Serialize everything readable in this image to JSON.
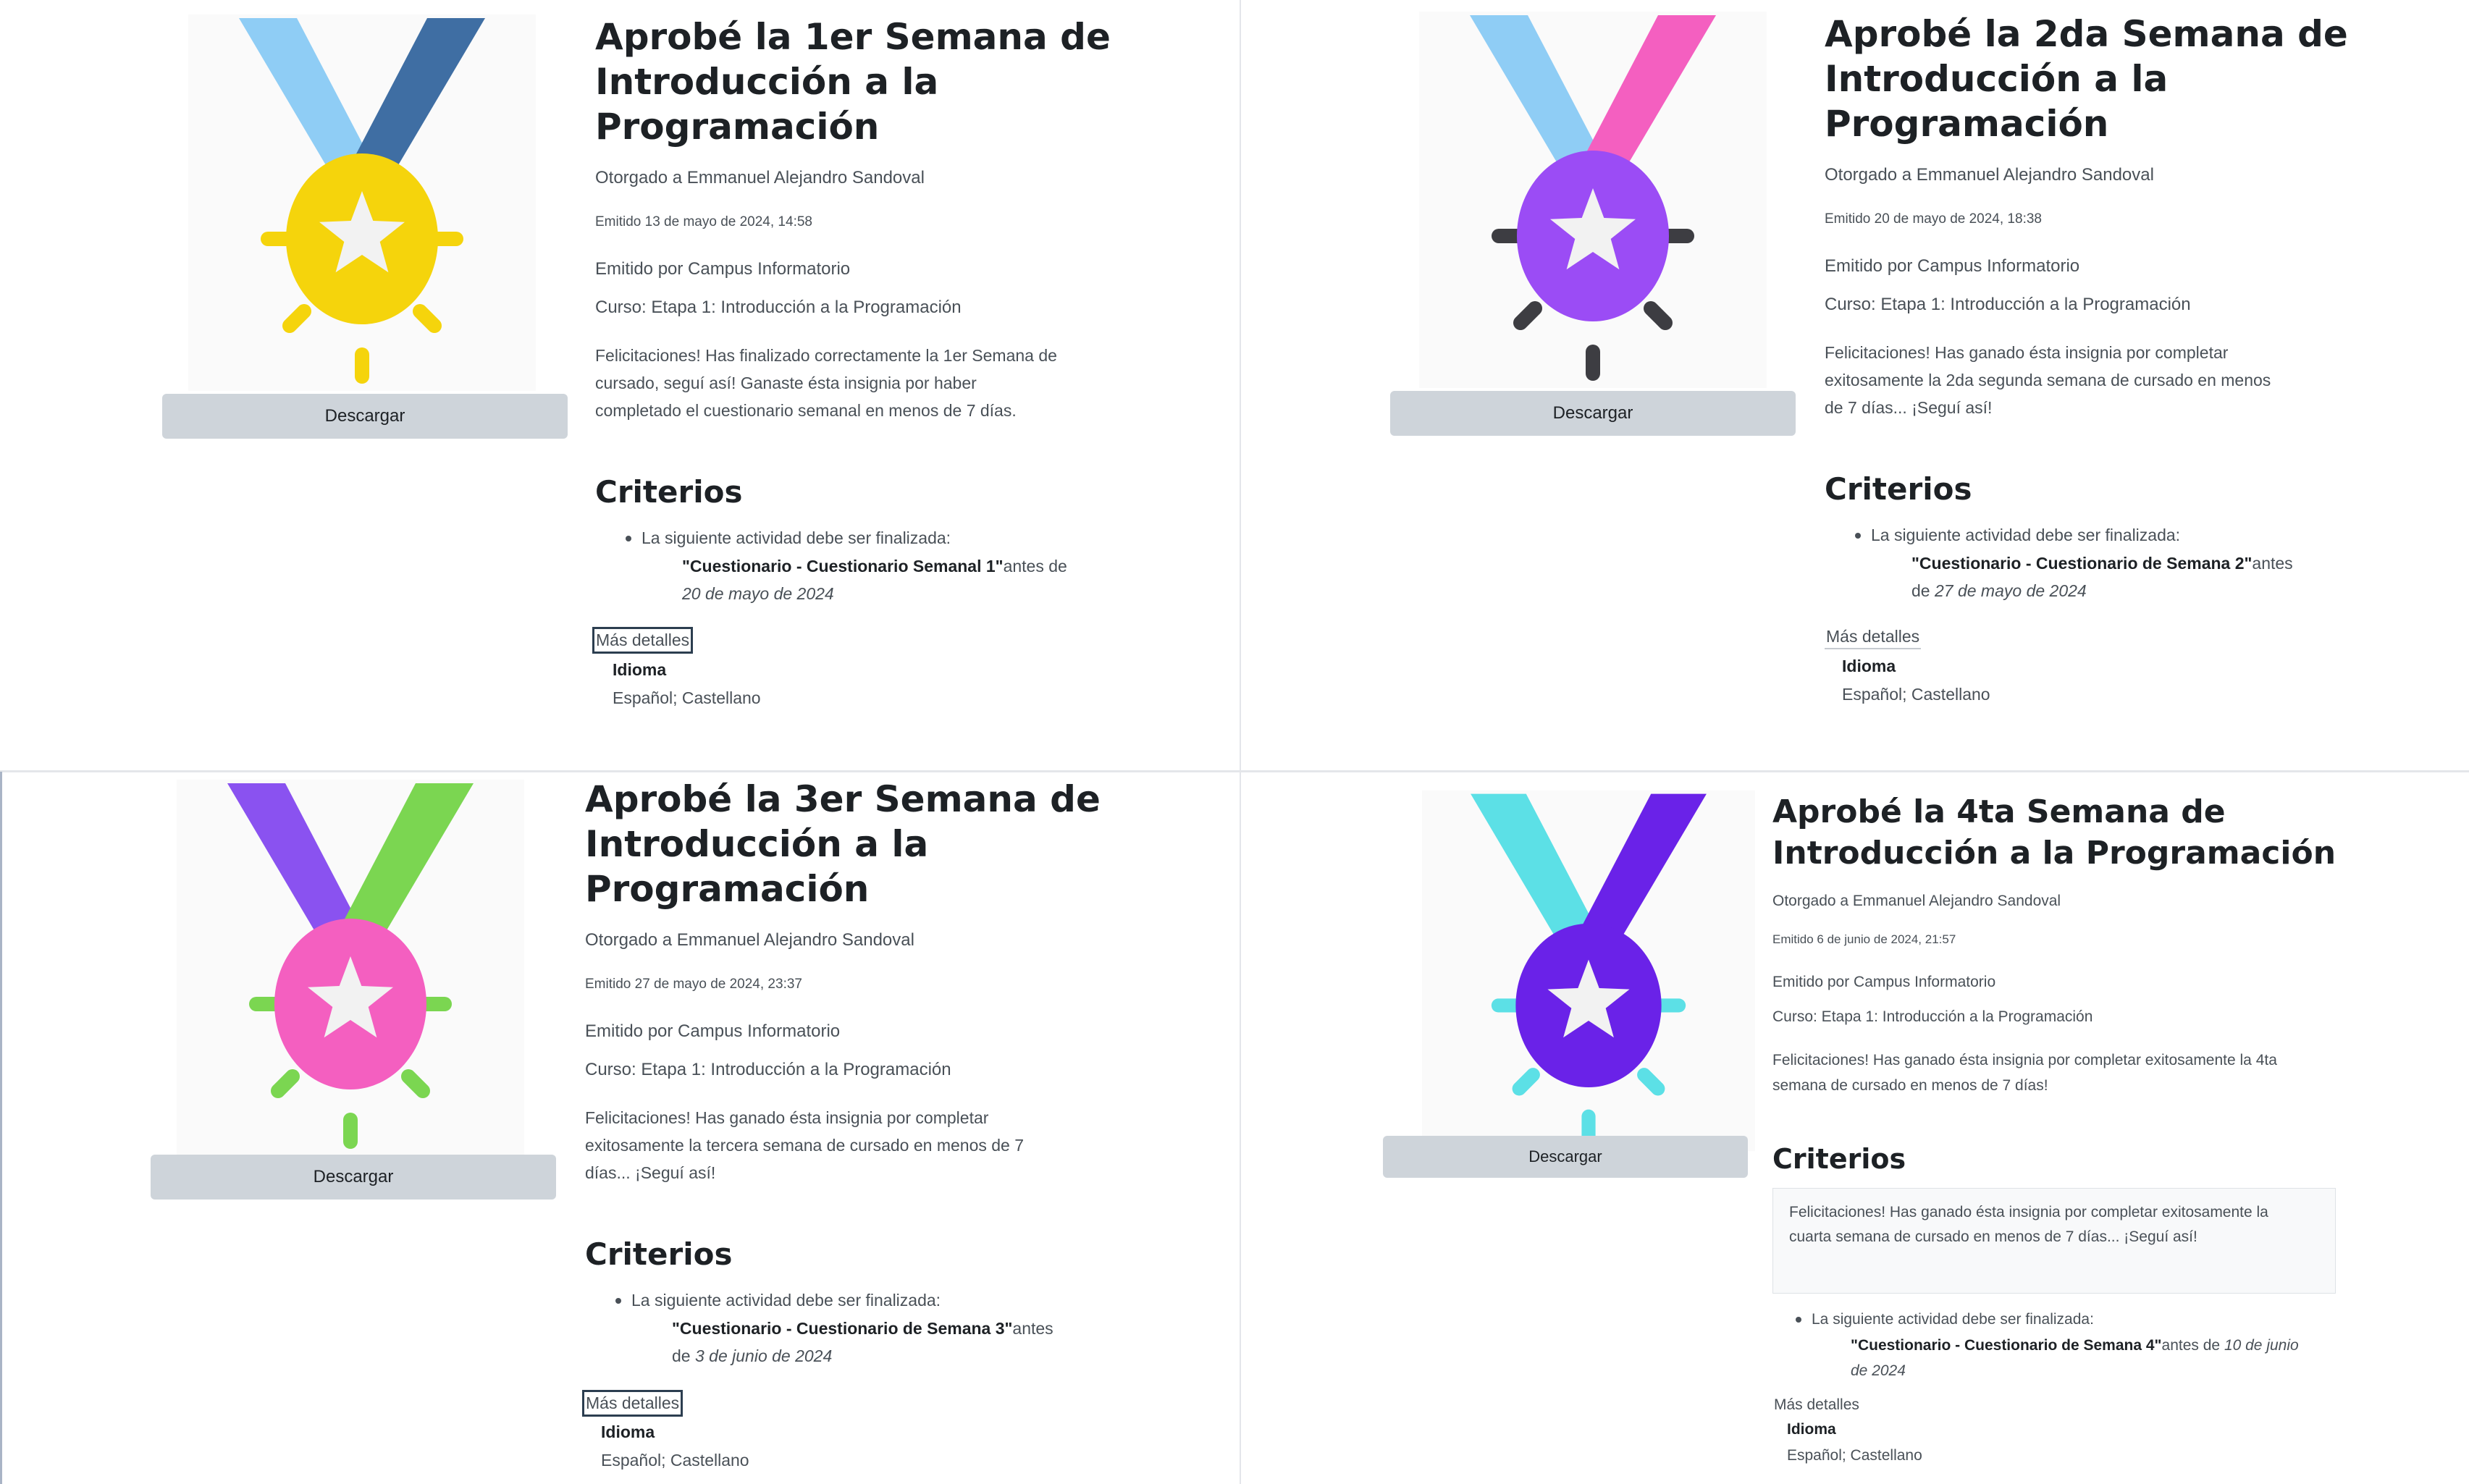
{
  "badges": [
    {
      "title_lines": [
        "Aprobé la 1er Semana de",
        "Introducción a la",
        "Programación"
      ],
      "awarded": "Otorgado a Emmanuel Alejandro Sandoval",
      "issued": "Emitido 13 de mayo de 2024, 14:58",
      "issuer": "Emitido por Campus Informatorio",
      "course": "Curso: Etapa 1: Introducción a la Programación",
      "desc_lines": [
        "Felicitaciones! Has finalizado correctamente la 1er Semana de",
        "cursado, seguí así! Ganaste ésta insignia por haber",
        "completado el cuestionario semanal en menos de 7 días."
      ],
      "download": "Descargar",
      "criteria_title": "Criterios",
      "criteria_intro": "La siguiente actividad debe ser finalizada:",
      "activity": "\"Cuestionario - Cuestionario Semanal 1\"",
      "before": "antes de",
      "deadline": "20 de mayo de 2024",
      "more": "Más detalles",
      "lang_label": "Idioma",
      "lang_value": "Español; Castellano",
      "colors": {
        "ribbon_left": "#8fcdf5",
        "ribbon_right": "#3f6ea3",
        "medal": "#f5d40c",
        "rays": "#f5d40c"
      }
    },
    {
      "title_lines": [
        "Aprobé la 2da Semana de",
        "Introducción a la",
        "Programación"
      ],
      "awarded": "Otorgado a Emmanuel Alejandro Sandoval",
      "issued": "Emitido 20 de mayo de 2024, 18:38",
      "issuer": "Emitido por Campus Informatorio",
      "course": "Curso: Etapa 1: Introducción a la Programación",
      "desc_lines": [
        "Felicitaciones! Has ganado ésta insignia por completar",
        "exitosamente la 2da segunda semana de cursado en menos",
        "de 7 días... ¡Seguí así!"
      ],
      "download": "Descargar",
      "criteria_title": "Criterios",
      "criteria_intro": "La siguiente actividad debe ser finalizada:",
      "activity": "\"Cuestionario - Cuestionario de Semana 2\"",
      "before": "antes",
      "deadline_prefix": "de",
      "deadline": "27 de mayo de 2024",
      "more": "Más detalles",
      "lang_label": "Idioma",
      "lang_value": "Español; Castellano",
      "colors": {
        "ribbon_left": "#8fcdf5",
        "ribbon_right": "#f45fc0",
        "medal": "#9b4cf5",
        "rays": "#3d3d42"
      }
    },
    {
      "title_lines": [
        "Aprobé la 3er Semana de",
        "Introducción a la",
        "Programación"
      ],
      "awarded": "Otorgado a Emmanuel Alejandro Sandoval",
      "issued": "Emitido 27 de mayo de 2024, 23:37",
      "issuer": "Emitido por Campus Informatorio",
      "course": "Curso: Etapa 1: Introducción a la Programación",
      "desc_lines": [
        "Felicitaciones! Has ganado ésta insignia por completar",
        "exitosamente la tercera semana de cursado en menos de 7",
        "días... ¡Seguí así!"
      ],
      "download": "Descargar",
      "criteria_title": "Criterios",
      "criteria_intro": "La siguiente actividad debe ser finalizada:",
      "activity": "\"Cuestionario - Cuestionario de Semana 3\"",
      "before": "antes",
      "deadline_prefix": "de",
      "deadline": "3 de junio de 2024",
      "more": "Más detalles",
      "lang_label": "Idioma",
      "lang_value": "Español; Castellano",
      "colors": {
        "ribbon_left": "#8a52f0",
        "ribbon_right": "#7bd651",
        "medal": "#f45fc0",
        "rays": "#7bd651"
      }
    },
    {
      "title_lines": [
        "Aprobé la 4ta Semana de",
        "Introducción a la Programación"
      ],
      "awarded": "Otorgado a Emmanuel Alejandro Sandoval",
      "issued": "Emitido 6 de junio de 2024, 21:57",
      "issuer": "Emitido por Campus Informatorio",
      "course": "Curso: Etapa 1: Introducción a la Programación",
      "desc_lines": [
        "Felicitaciones! Has ganado ésta insignia por completar exitosamente la 4ta",
        "semana de cursado en menos de 7 días!"
      ],
      "download": "Descargar",
      "criteria_title": "Criterios",
      "criteria_note_lines": [
        "Felicitaciones! Has ganado ésta insignia por completar exitosamente la",
        "cuarta semana de cursado en menos de 7 días... ¡Seguí así!"
      ],
      "criteria_intro": "La siguiente actividad debe ser finalizada:",
      "activity": "\"Cuestionario - Cuestionario de Semana 4\"",
      "before": "antes de",
      "deadline": "10 de junio",
      "deadline_cont": "de 2024",
      "more": "Más detalles",
      "lang_label": "Idioma",
      "lang_value": "Español; Castellano",
      "colors": {
        "ribbon_left": "#5ce0e6",
        "ribbon_right": "#6a22e8",
        "medal": "#6a22e8",
        "rays": "#5ce0e6"
      }
    }
  ]
}
